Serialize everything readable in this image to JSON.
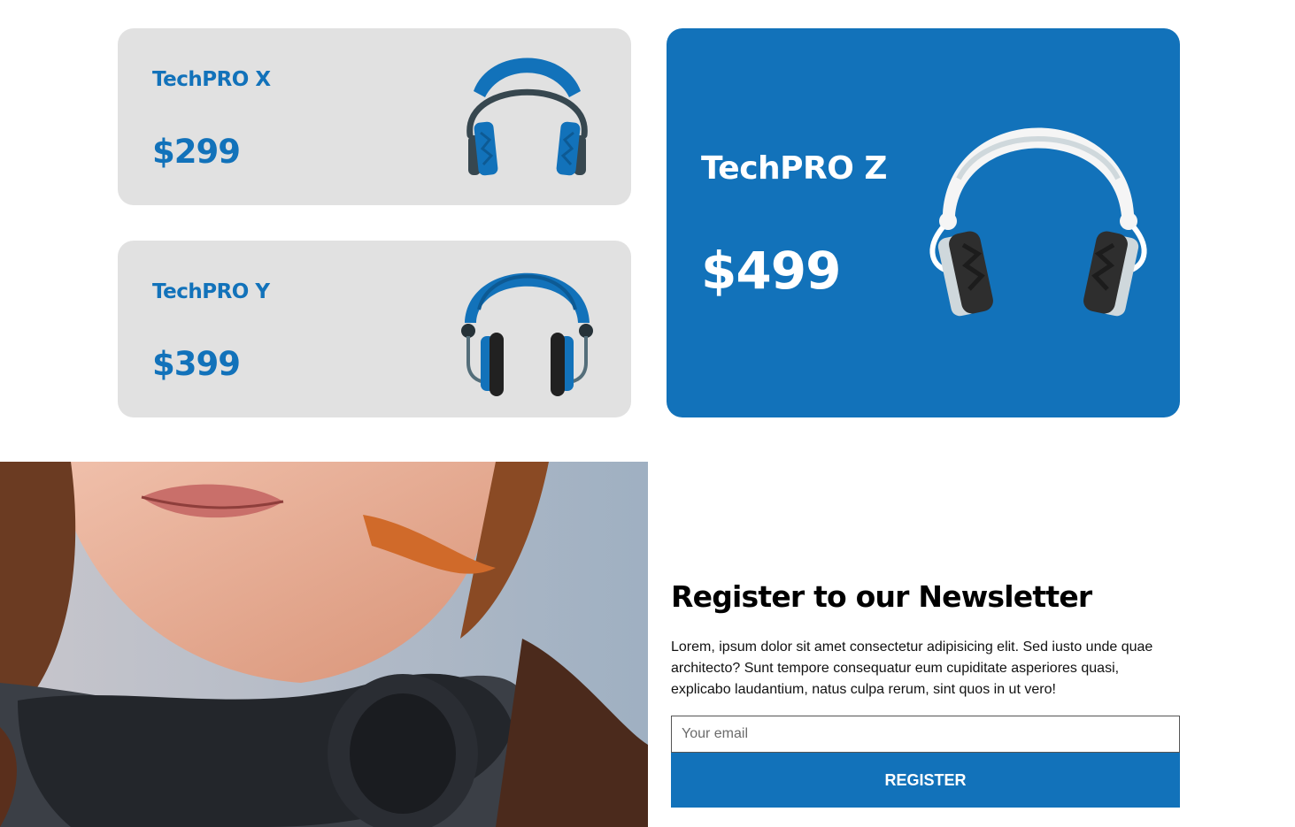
{
  "products": [
    {
      "name": "TechPRO X",
      "price": "$299",
      "image_icon": "headphones-icon"
    },
    {
      "name": "TechPRO Y",
      "price": "$399",
      "image_icon": "headphones-icon"
    },
    {
      "name": "TechPRO Z",
      "price": "$499",
      "image_icon": "headphones-icon"
    }
  ],
  "newsletter": {
    "title": "Register to our Newsletter",
    "text": "Lorem, ipsum dolor sit amet consectetur adipisicing elit. Sed iusto unde quae architecto? Sunt tempore consequatur eum cupiditate asperiores quasi, explicabo laudantium, natus culpa rerum, sint quos in ut vero!",
    "email_placeholder": "Your email",
    "button_label": "Register"
  },
  "colors": {
    "brand_blue": "#1272ba",
    "card_gray": "#e1e1e1"
  }
}
